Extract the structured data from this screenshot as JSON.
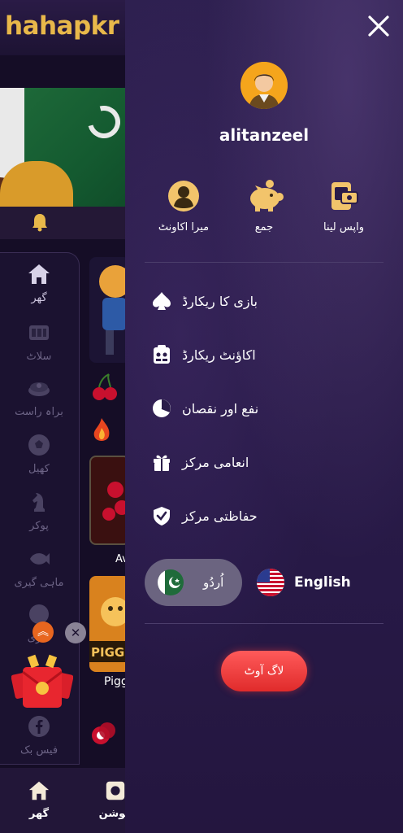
{
  "background_app": {
    "logo": "hahapkr",
    "sidebar_items": [
      {
        "label": "گھر",
        "icon": "home-icon",
        "active": true
      },
      {
        "label": "سلاٹ",
        "icon": "slot-machine-icon"
      },
      {
        "label": "براہ راست",
        "icon": "roulette-icon"
      },
      {
        "label": "کھیل",
        "icon": "soccer-ball-icon"
      },
      {
        "label": "پوکر",
        "icon": "chess-knight-icon"
      },
      {
        "label": "ماہی گیری",
        "icon": "fish-icon"
      },
      {
        "label": "لاٹری",
        "icon": "lottery-ball-icon"
      },
      {
        "label": "فیس بک",
        "icon": "facebook-icon"
      }
    ],
    "game_labels": {
      "aviator_partial": "Av",
      "piggy_partial": "Pigg"
    },
    "bottom_nav": [
      {
        "label": "گھر",
        "icon": "home-icon"
      },
      {
        "label": "موشن",
        "icon": "promotion-icon"
      }
    ]
  },
  "drawer": {
    "username": "alitanzeel",
    "quick_actions": [
      {
        "label": "میرا اکاونٹ",
        "icon": "account-icon"
      },
      {
        "label": "جمع",
        "icon": "piggy-bank-icon"
      },
      {
        "label": "واپس لینا",
        "icon": "withdraw-icon"
      }
    ],
    "menu": [
      {
        "label": "بازی کا ریکارڈ",
        "icon": "spade-icon"
      },
      {
        "label": "اکاؤنٹ ریکارڈ",
        "icon": "account-record-icon"
      },
      {
        "label": "نفع اور نقصان",
        "icon": "pie-chart-icon"
      },
      {
        "label": "انعامی مرکز",
        "icon": "gift-icon"
      },
      {
        "label": "حفاظتی مرکز",
        "icon": "shield-check-icon"
      }
    ],
    "languages": [
      {
        "label": "اُردُو",
        "selected": true
      },
      {
        "label": "English",
        "selected": false
      }
    ],
    "logout_label": "لاگ آوٹ"
  },
  "colors": {
    "accent_gold": "#e8b84a",
    "logout_red": "#e02b2b",
    "drawer_bg": "#2a1c49"
  }
}
